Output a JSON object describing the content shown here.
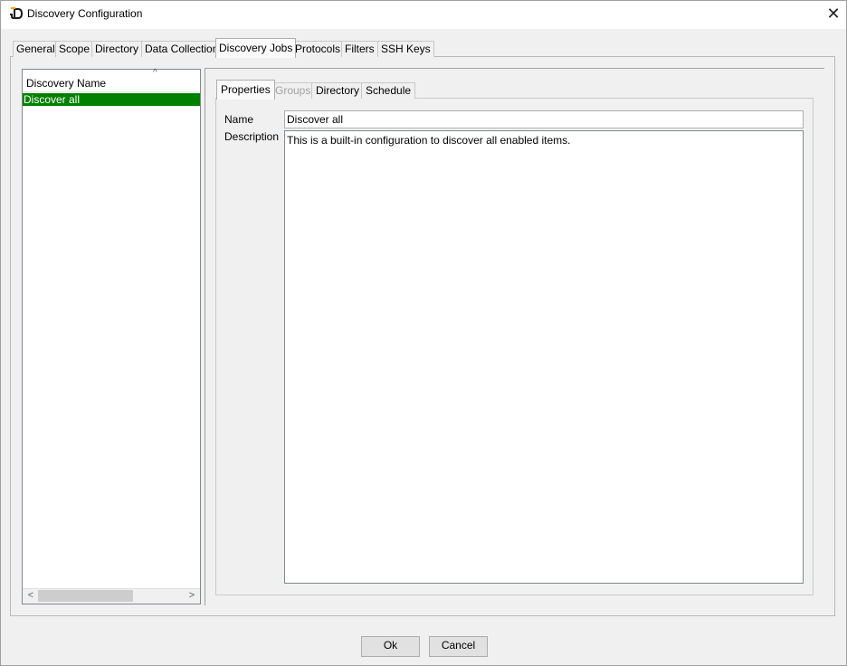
{
  "window": {
    "title": "Discovery Configuration",
    "logo_icon": "jd-logo-icon",
    "close_glyph": "✕"
  },
  "top_tabs": [
    {
      "label": "General"
    },
    {
      "label": "Scope"
    },
    {
      "label": "Directory"
    },
    {
      "label": "Data Collection"
    },
    {
      "label": "Discovery Jobs",
      "active": true
    },
    {
      "label": "Protocols"
    },
    {
      "label": "Filters"
    },
    {
      "label": "SSH Keys"
    }
  ],
  "job_list": {
    "column_header": "Discovery Name",
    "sort_glyph": "^",
    "rows": [
      {
        "label": "Discover all",
        "selected": true
      }
    ],
    "selection_color": "#008000"
  },
  "inner_tabs": [
    {
      "label": "Properties",
      "active": true
    },
    {
      "label": "Groups",
      "disabled": true
    },
    {
      "label": "Directory"
    },
    {
      "label": "Schedule"
    }
  ],
  "properties": {
    "name_label": "Name",
    "name_value": "Discover all",
    "description_label": "Description",
    "description_value": "This is a built-in configuration to discover all enabled items."
  },
  "scroll": {
    "left_glyph": "<",
    "right_glyph": ">"
  },
  "buttons": {
    "ok_label": "Ok",
    "cancel_label": "Cancel"
  }
}
